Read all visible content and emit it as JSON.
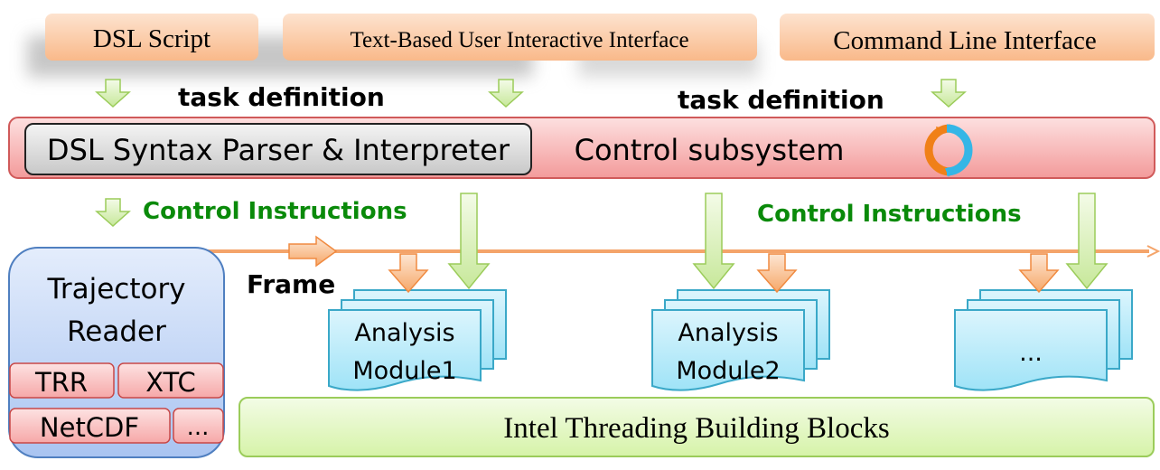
{
  "inputs": {
    "dsl_script": "DSL Script",
    "text_ui": "Text-Based User Interactive Interface",
    "cli": "Command Line Interface"
  },
  "labels": {
    "task_definition_left": "task definition",
    "task_definition_right": "task definition",
    "control_instructions_left": "Control Instructions",
    "control_instructions_right": "Control Instructions",
    "frame": "Frame"
  },
  "control": {
    "parser": "DSL Syntax Parser & Interpreter",
    "subsystem": "Control subsystem",
    "icon": "cycle-arrows-icon"
  },
  "reader": {
    "title_line1": "Trajectory",
    "title_line2": "Reader",
    "formats": [
      "TRR",
      "XTC",
      "NetCDF",
      "..."
    ]
  },
  "modules": [
    {
      "line1": "Analysis",
      "line2": "Module1"
    },
    {
      "line1": "Analysis",
      "line2": "Module2"
    },
    {
      "line1": "...",
      "line2": ""
    }
  ],
  "tbb": "Intel Threading Building Blocks",
  "colors": {
    "input_box": "#fbc9a2",
    "control_bar": "#f8a8a8",
    "parser_box": "#d9d9d9",
    "reader_box": "#b9d0f5",
    "format_box": "#f9b4b4",
    "module": "#aee7f7",
    "tbb": "#e2f7c2",
    "green_arrow": "#9bcc5a",
    "orange_arrow": "#f4a46a",
    "green_text": "#0a8a0a"
  }
}
